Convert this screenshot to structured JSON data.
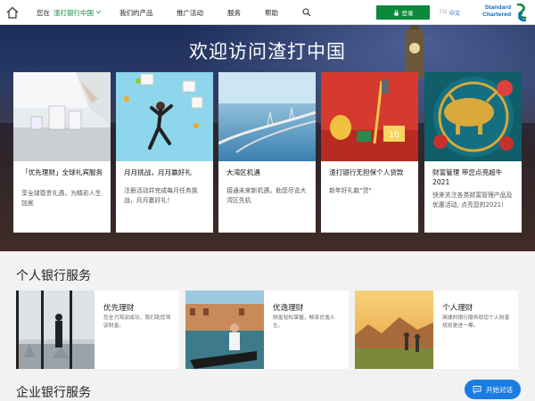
{
  "nav": {
    "location_label": "您在",
    "location_name": "渣打银行中国",
    "products": "我们的产品",
    "promotions": "推广活动",
    "services": "服务",
    "help": "帮助",
    "login": "登录",
    "lang_en": "EN",
    "lang_sep": "|",
    "lang_zh": "中文",
    "logo_line1": "Standard",
    "logo_line2": "Chartered"
  },
  "hero": {
    "title": "欢迎访问渣打中国",
    "cards": [
      {
        "title": "「优先理财」全球礼宾服务",
        "desc": "享全球尊贵礼遇，为精彩人生加冕"
      },
      {
        "title": "月月挑战，月月赢好礼",
        "desc": "注册活动并完成每月任务挑战，月月赢好礼！"
      },
      {
        "title": "大湾区机遇",
        "desc": "接通未来新机遇，助您尽览大湾区先机"
      },
      {
        "title": "渣打银行无担保个人贷款",
        "desc": "新年好礼款\"贷\""
      },
      {
        "title": "财富管理 带您点亮超牛2021",
        "desc": "快来关注各类财富管理产品及优惠活动, 点亮您的2021!"
      }
    ]
  },
  "personal": {
    "title": "个人银行服务",
    "cards": [
      {
        "title": "优先理财",
        "desc": "您全力驾驭成功，我们助您驾驭财富。"
      },
      {
        "title": "优逸理财",
        "desc": "财富轻松掌握，畅享优逸人生。"
      },
      {
        "title": "个人理财",
        "desc": "简捷的银行服务助您个人财富规划更进一筹。"
      }
    ]
  },
  "corporate": {
    "title": "企业银行服务"
  },
  "chat": {
    "label": "开始对话"
  },
  "colors": {
    "brand_green": "#0a8a3a",
    "brand_blue": "#0a6fc2",
    "chat_blue": "#1a7ce0"
  }
}
